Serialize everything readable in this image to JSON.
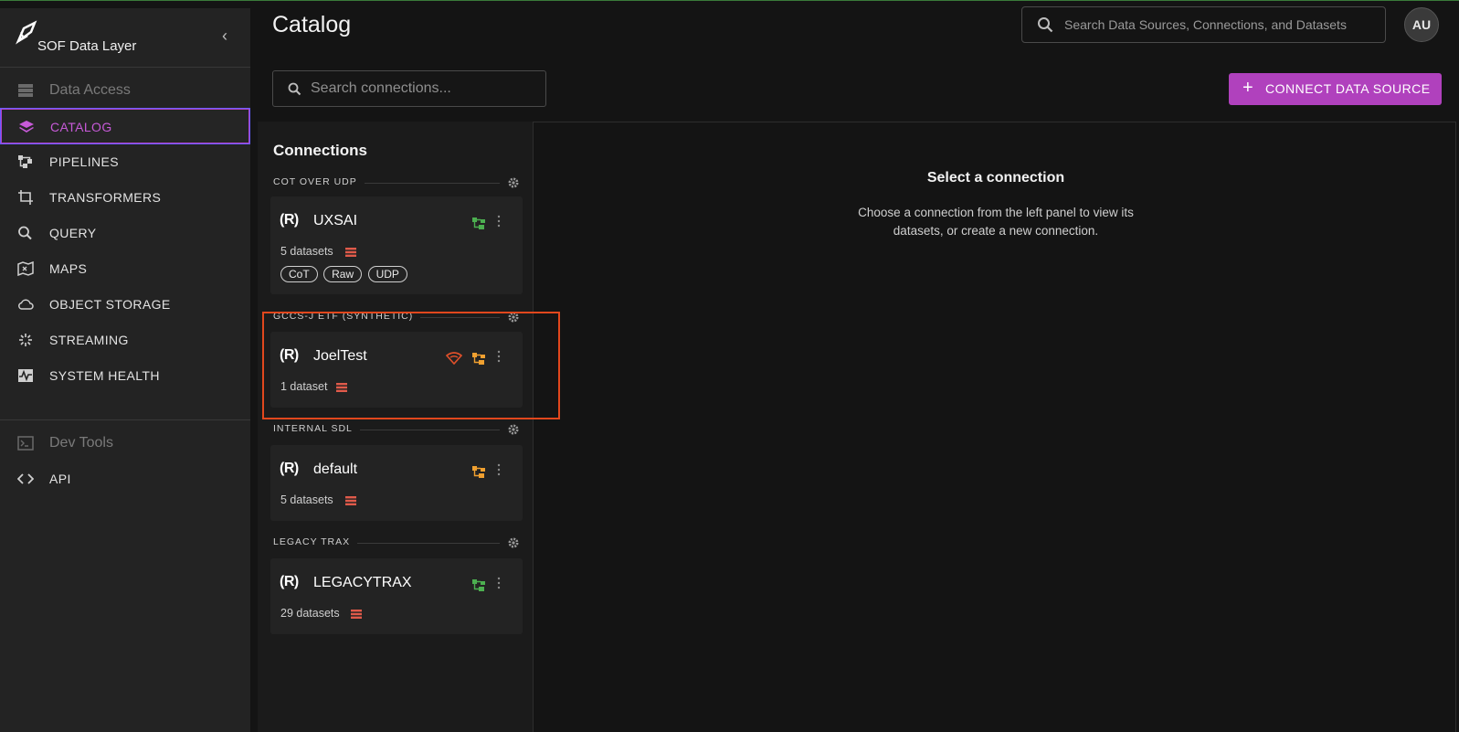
{
  "app": {
    "name": "SOF Data Layer"
  },
  "sidebar": {
    "sections": [
      {
        "header": "Data Access"
      },
      {
        "header": "Dev Tools"
      }
    ],
    "items": [
      {
        "label": "CATALOG",
        "icon": "layers-icon",
        "active": true
      },
      {
        "label": "PIPELINES",
        "icon": "pipeline-icon"
      },
      {
        "label": "TRANSFORMERS",
        "icon": "crop-icon"
      },
      {
        "label": "QUERY",
        "icon": "search-icon"
      },
      {
        "label": "MAPS",
        "icon": "map-icon"
      },
      {
        "label": "OBJECT STORAGE",
        "icon": "cloud-icon"
      },
      {
        "label": "STREAMING",
        "icon": "streaming-icon"
      },
      {
        "label": "SYSTEM HEALTH",
        "icon": "health-icon"
      },
      {
        "label": "API",
        "icon": "code-icon"
      }
    ]
  },
  "header": {
    "title": "Catalog",
    "search_placeholder": "Search Data Sources, Connections, and Datasets",
    "avatar": "AU"
  },
  "toolbar": {
    "connection_search_placeholder": "Search connections...",
    "connect_label": "CONNECT DATA SOURCE"
  },
  "connections": {
    "title": "Connections",
    "groups": [
      {
        "name": "COT OVER UDP",
        "card": {
          "name": "UXSAI",
          "datasets": "5 datasets",
          "tags": [
            "CoT",
            "Raw",
            "UDP"
          ],
          "status_color": "#4caf50"
        }
      },
      {
        "name": "GCCS-J ETF (SYNTHETIC)",
        "card": {
          "name": "JoelTest",
          "datasets": "1 dataset",
          "status_color": "#f0a030",
          "warning": true
        }
      },
      {
        "name": "INTERNAL SDL",
        "card": {
          "name": "default",
          "datasets": "5 datasets",
          "status_color": "#f0a030"
        }
      },
      {
        "name": "LEGACY TRAX",
        "card": {
          "name": "LEGACYTRAX",
          "datasets": "29 datasets",
          "status_color": "#4caf50"
        }
      }
    ],
    "logo_text": "(R)"
  },
  "detail": {
    "title": "Select a connection",
    "text": "Choose a connection from the left panel to view its datasets, or create a new connection."
  },
  "colors": {
    "accent": "#b041bd",
    "highlight": "#e1471d",
    "warning": "#e0502a",
    "dataset_icon": "#e05a4a"
  }
}
